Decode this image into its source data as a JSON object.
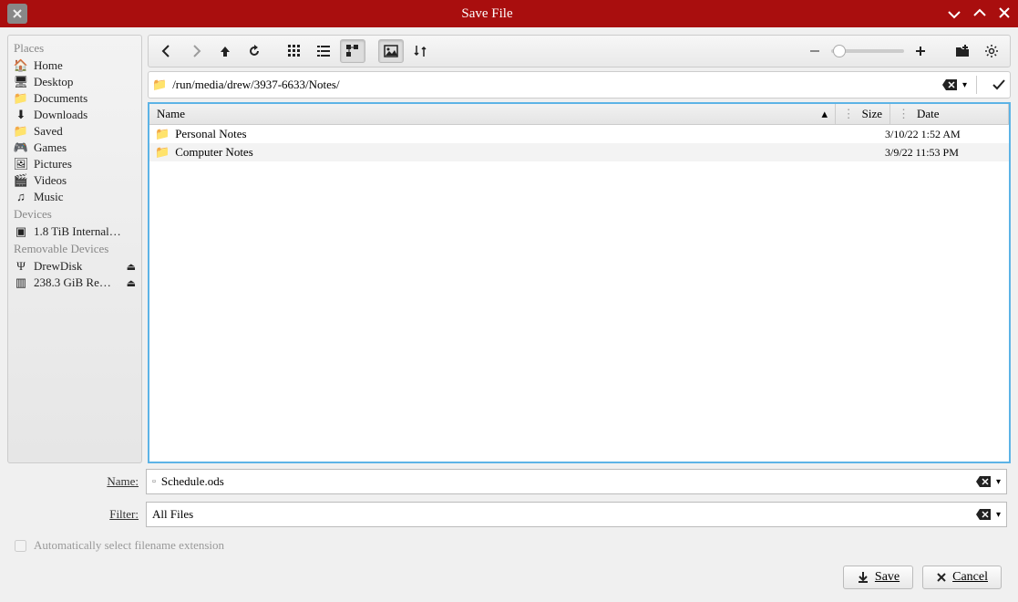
{
  "title": "Save File",
  "sidebar": {
    "places_head": "Places",
    "places": [
      {
        "icon": "home",
        "label": "Home"
      },
      {
        "icon": "desktop",
        "label": "Desktop"
      },
      {
        "icon": "folder",
        "label": "Documents"
      },
      {
        "icon": "download",
        "label": "Downloads"
      },
      {
        "icon": "folder",
        "label": "Saved"
      },
      {
        "icon": "games",
        "label": "Games"
      },
      {
        "icon": "pictures",
        "label": "Pictures"
      },
      {
        "icon": "videos",
        "label": "Videos"
      },
      {
        "icon": "music",
        "label": "Music"
      }
    ],
    "devices_head": "Devices",
    "devices": [
      {
        "icon": "disk",
        "label": "1.8 TiB Internal…"
      }
    ],
    "removable_head": "Removable Devices",
    "removable": [
      {
        "icon": "usb",
        "label": "DrewDisk",
        "eject": true
      },
      {
        "icon": "sd",
        "label": "238.3 GiB Re…",
        "eject": true
      }
    ]
  },
  "path": "/run/media/drew/3937-6633/Notes/",
  "columns": {
    "name": "Name",
    "size": "Size",
    "date": "Date"
  },
  "files": [
    {
      "name": "Personal Notes",
      "size": "",
      "date": "3/10/22 1:52 AM"
    },
    {
      "name": "Computer Notes",
      "size": "",
      "date": "3/9/22 11:53 PM"
    }
  ],
  "name_label": "Name:",
  "name_value": "Schedule.ods",
  "filter_label": "Filter:",
  "filter_value": "All Files",
  "auto_ext": "Automatically select filename extension",
  "save_btn": "Save",
  "cancel_btn": "Cancel"
}
